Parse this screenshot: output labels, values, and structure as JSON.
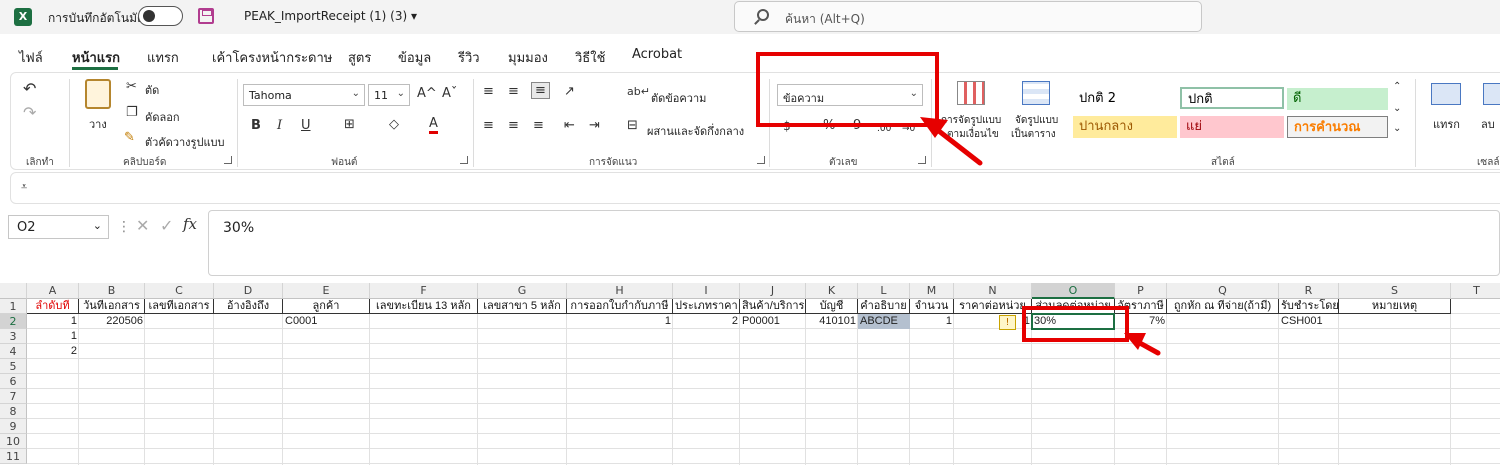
{
  "titlebar": {
    "app_icon": "X",
    "autosave_label": "การบันทึกอัตโนมัติ",
    "document_title": "PEAK_ImportReceipt (1) (3)",
    "title_dropdown": "▾",
    "search_placeholder": "ค้นหา (Alt+Q)"
  },
  "menu": {
    "tabs": [
      "ไฟล์",
      "หน้าแรก",
      "แทรก",
      "เค้าโครงหน้ากระดาษ",
      "สูตร",
      "ข้อมูล",
      "รีวิว",
      "มุมมอง",
      "วิธีใช้",
      "Acrobat"
    ],
    "active": "หน้าแรก"
  },
  "ribbon": {
    "undo_group_label": "เลิกทำ",
    "clipboard": {
      "paste": "วาง",
      "cut": "ตัด",
      "copy": "คัดลอก",
      "format_painter": "ตัวคัดวางรูปแบบ",
      "label": "คลิปบอร์ด"
    },
    "font": {
      "name": "Tahoma",
      "size": "11",
      "label": "ฟอนต์",
      "bold": "B",
      "italic": "I",
      "underline": "U",
      "grow": "A^",
      "shrink": "Aˇ",
      "font_color_letter": "A"
    },
    "alignment": {
      "wrap_text": "ตัดข้อความ",
      "merge_center": "ผสานและจัดกึ่งกลาง",
      "label": "การจัดแนว"
    },
    "number": {
      "format": "ข้อความ",
      "label": "ตัวเลข",
      "percent": "%",
      "comma": "9",
      "inc_decimal": ".00",
      "dec_decimal": "→0"
    },
    "styles": {
      "conditional": [
        "การจัดรูปแบบ",
        "ตามเงื่อนไข"
      ],
      "format_table": [
        "จัดรูปแบบ",
        "เป็นตาราง"
      ],
      "cells": [
        {
          "text": "ปกติ 2",
          "bg": "#ffffff",
          "fg": "#000000"
        },
        {
          "text": "ปกติ",
          "bg": "#ffffff",
          "fg": "#000000"
        },
        {
          "text": "ดี",
          "bg": "#c6efce",
          "fg": "#006100"
        },
        {
          "text": "ปานกลาง",
          "bg": "#ffeb9c",
          "fg": "#9c5700"
        },
        {
          "text": "แย่",
          "bg": "#ffc7ce",
          "fg": "#9c0006"
        },
        {
          "text": "การคำนวณ",
          "bg": "#f2f2f2",
          "fg": "#fa7d00"
        }
      ],
      "label": "สไตล์"
    },
    "cells_group": {
      "insert": "แทรก",
      "delete": "ลบ",
      "label": "เซลล์"
    }
  },
  "formula_bar": {
    "name_box": "O2",
    "value": "30%",
    "fx": "fx"
  },
  "sheet": {
    "columns": [
      "A",
      "B",
      "C",
      "D",
      "E",
      "F",
      "G",
      "H",
      "I",
      "J",
      "K",
      "L",
      "M",
      "N",
      "O",
      "P",
      "Q",
      "R",
      "S",
      "T"
    ],
    "selected_column": "O",
    "rows": [
      "1",
      "2",
      "3",
      "4",
      "5",
      "6",
      "7",
      "8",
      "9",
      "10",
      "11"
    ],
    "selected_row": "2",
    "headers": [
      "ลำดับที่",
      "วันที่เอกสาร",
      "เลขที่เอกสาร",
      "อ้างอิงถึง",
      "ลูกค้า",
      "เลขทะเบียน 13 หลัก",
      "เลขสาขา 5 หลัก",
      "การออกใบกำกับภาษี",
      "ประเภทราคา",
      "สินค้า/บริการ",
      "บัญชี",
      "คำอธิบาย",
      "จำนวน",
      "ราคาต่อหน่วย",
      "ส่วนลดต่อหน่วย",
      "อัตราภาษี",
      "ถูกหัก ณ ที่จ่าย(ถ้ามี)",
      "รับชำระโดย",
      "หมายเหตุ"
    ],
    "row2": [
      "1",
      "220506",
      "",
      "",
      "C0001",
      "",
      "",
      "1",
      "2",
      "P00001",
      "410101",
      "ABCDE",
      "1",
      "1",
      "30%",
      "7%",
      "",
      "CSH001",
      ""
    ],
    "row3_a": "1",
    "row4_a": "2",
    "warning_icon": "!"
  }
}
